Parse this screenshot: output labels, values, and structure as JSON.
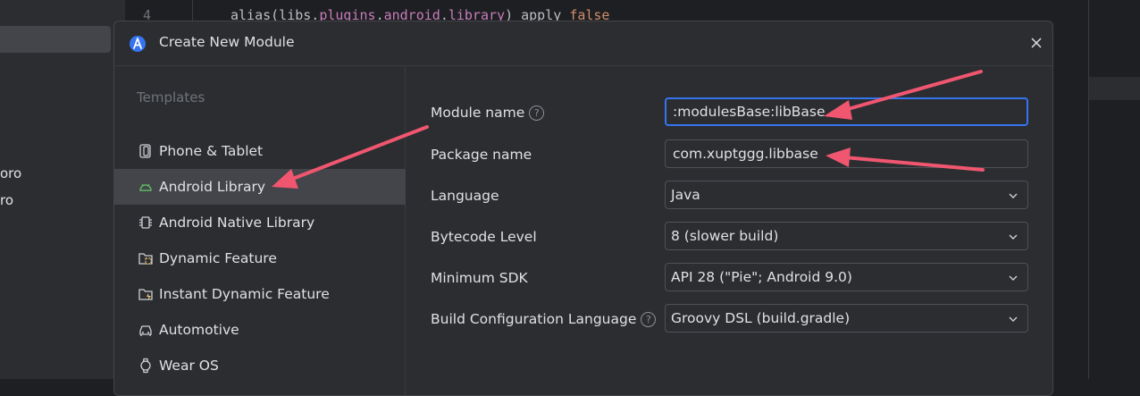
{
  "editor": {
    "line_number": "4",
    "code_prefix": "alias(libs.",
    "code_plugins": "plugins",
    "code_dot1": ".",
    "code_android": "android",
    "code_dot2": ".",
    "code_library": "library",
    "code_apply": ") apply ",
    "code_false": "false",
    "left_fragment_1": "oro",
    "left_fragment_2": "ro"
  },
  "dialog": {
    "title": "Create New Module",
    "close_icon": "close-icon"
  },
  "templates": {
    "header": "Templates",
    "items": [
      {
        "label": "Phone & Tablet",
        "icon": "phone-tablet-icon",
        "selected": false
      },
      {
        "label": "Android Library",
        "icon": "android-icon",
        "selected": true
      },
      {
        "label": "Android Native Library",
        "icon": "native-library-icon",
        "selected": false
      },
      {
        "label": "Dynamic Feature",
        "icon": "dynamic-feature-icon",
        "selected": false
      },
      {
        "label": "Instant Dynamic Feature",
        "icon": "instant-dynamic-feature-icon",
        "selected": false
      },
      {
        "label": "Automotive",
        "icon": "car-icon",
        "selected": false
      },
      {
        "label": "Wear OS",
        "icon": "watch-icon",
        "selected": false
      }
    ]
  },
  "form": {
    "module_name": {
      "label": "Module name",
      "value": ":modulesBase:libBase"
    },
    "package_name": {
      "label": "Package name",
      "value": "com.xuptggg.libbase"
    },
    "language": {
      "label": "Language",
      "value": "Java"
    },
    "bytecode_level": {
      "label": "Bytecode Level",
      "value": "8 (slower build)"
    },
    "minimum_sdk": {
      "label": "Minimum SDK",
      "value": "API 28 (\"Pie\"; Android 9.0)"
    },
    "build_config_language": {
      "label": "Build Configuration Language",
      "value": "Groovy DSL (build.gradle)"
    }
  },
  "colors": {
    "accent": "#3574f0",
    "annotation_arrow": "#f0566f",
    "dialog_bg": "#2b2d30",
    "selected_item": "#43454a"
  }
}
